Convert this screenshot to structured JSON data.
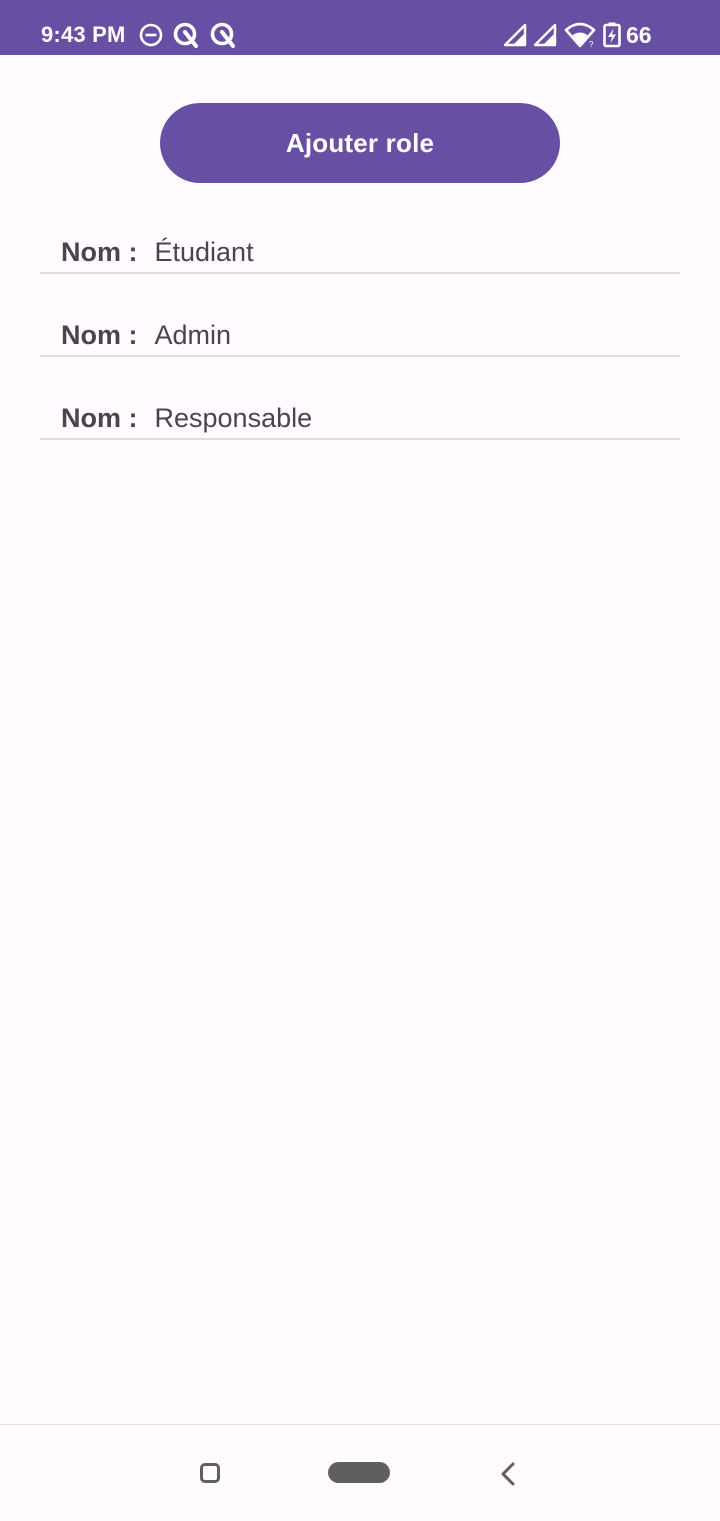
{
  "status_bar": {
    "time": "9:43 PM",
    "battery_level": "66",
    "icons": [
      "do-not-disturb-icon",
      "q-app-icon",
      "q-app-icon",
      "signal-icon",
      "signal-icon",
      "wifi-icon",
      "battery-charging-icon"
    ],
    "background": "#6750a4"
  },
  "actions": {
    "add_role_label": "Ajouter role"
  },
  "roles": [
    {
      "label": "Nom :",
      "name": "Étudiant"
    },
    {
      "label": "Nom :",
      "name": "Admin"
    },
    {
      "label": "Nom :",
      "name": "Responsable"
    }
  ],
  "navigation": {
    "icons": [
      "recents-icon",
      "home-icon",
      "back-icon"
    ]
  },
  "colors": {
    "accent": "#6750a4",
    "background": "#fffbfe",
    "text": "#49454f",
    "divider": "#e0dde2"
  }
}
